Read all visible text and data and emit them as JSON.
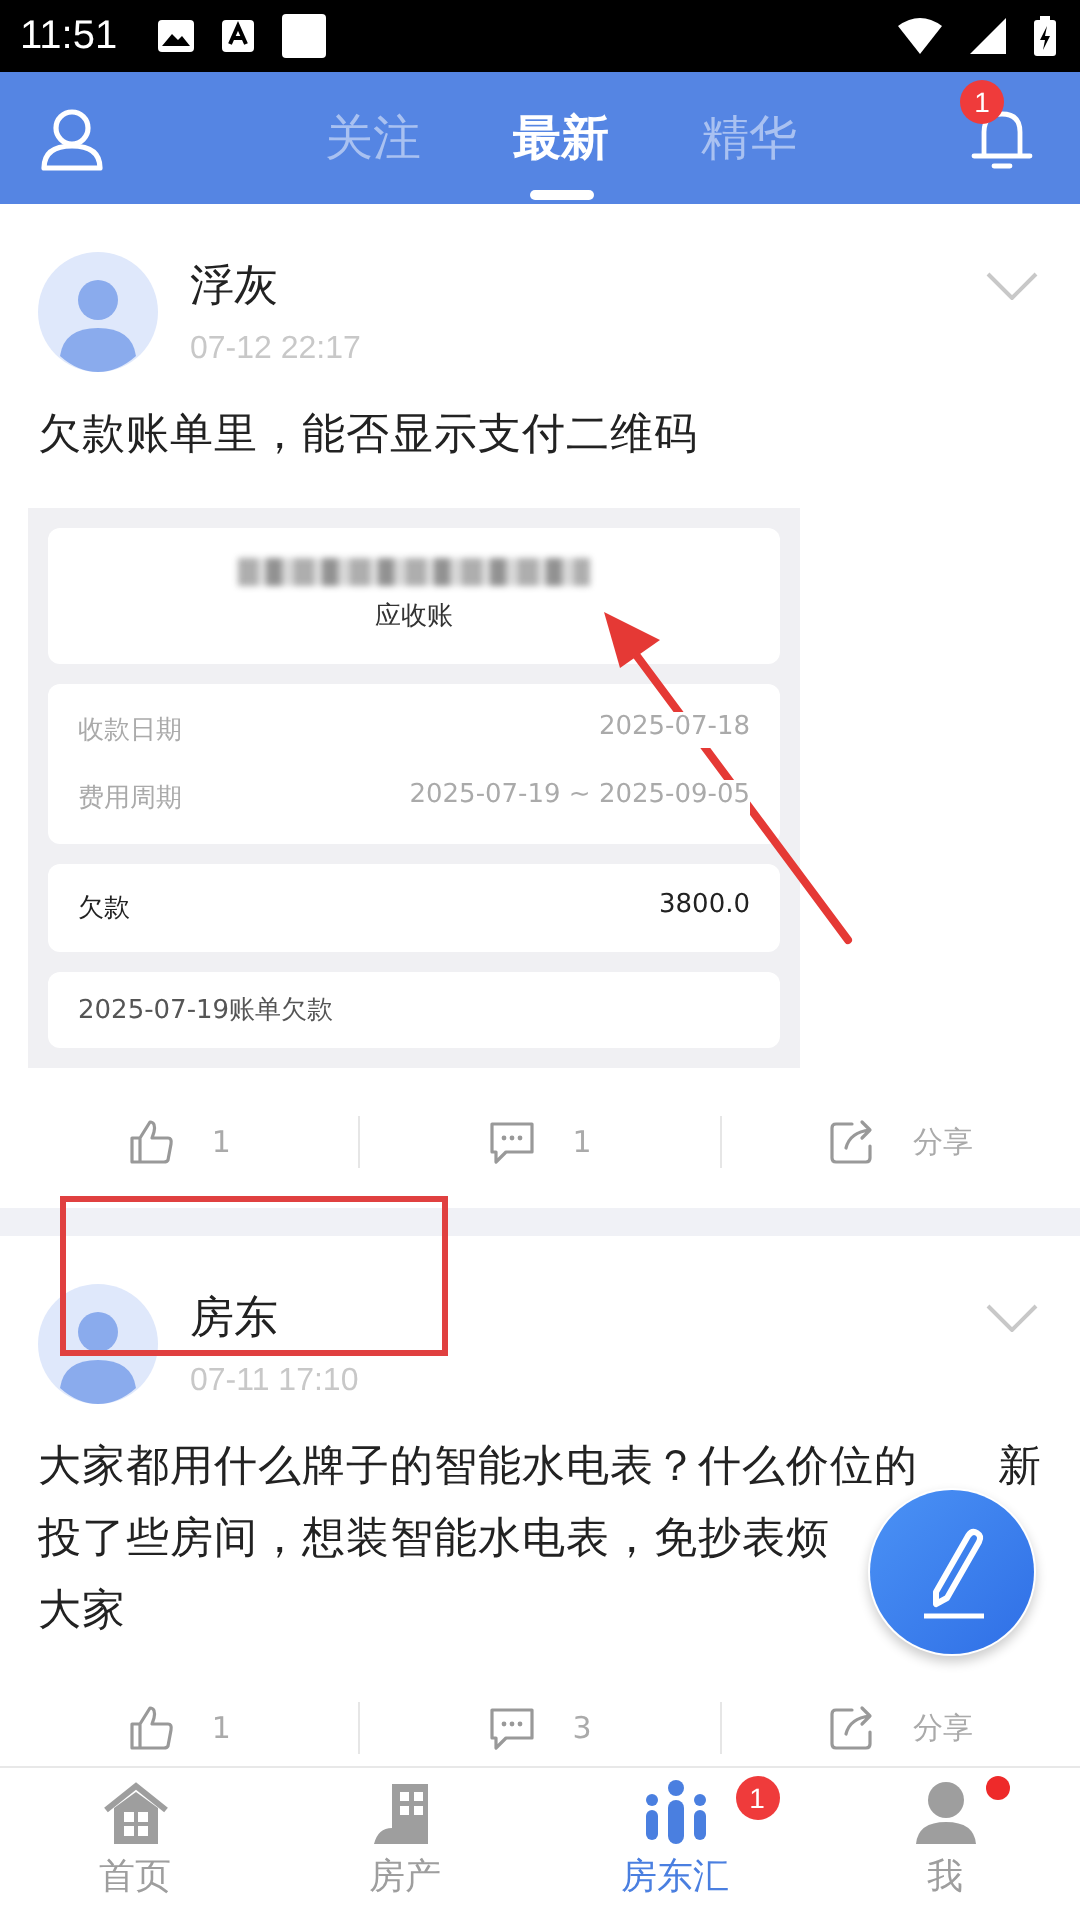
{
  "status_bar": {
    "time": "11:51"
  },
  "header": {
    "tabs": [
      {
        "label": "关注",
        "selected": false
      },
      {
        "label": "最新",
        "selected": true
      },
      {
        "label": "精华",
        "selected": false
      }
    ],
    "notification_badge": "1"
  },
  "posts": [
    {
      "author": "浮灰",
      "time": "07-12 22:17",
      "lines": [
        [
          "欠款账单里，能否显示支付二维码"
        ]
      ],
      "attachment": {
        "subtitle": "应收账",
        "details": [
          {
            "label": "收款日期",
            "value": "2025-07-18"
          },
          {
            "label": "费用周期",
            "value": "2025-07-19 ~ 2025-09-05"
          }
        ],
        "debt_label": "欠款",
        "debt_value": "3800.0",
        "note": "2025-07-19账单欠款"
      },
      "likes": "1",
      "comments": "1",
      "share": "分享"
    },
    {
      "author": "房东",
      "time": "07-11 17:10",
      "lines": [
        [
          "大家都用什么牌子的智能水电表？什么价位的",
          "新"
        ],
        [
          "投了些房间，想装智能水电表，免抄表烦"
        ],
        [
          "大家"
        ]
      ],
      "likes": "1",
      "comments": "3",
      "share": "分享"
    }
  ],
  "bottom_nav": [
    {
      "label": "首页",
      "selected": false
    },
    {
      "label": "房产",
      "selected": false
    },
    {
      "label": "房东汇",
      "selected": true,
      "badge": "1"
    },
    {
      "label": "我",
      "selected": false,
      "dot": true
    }
  ]
}
